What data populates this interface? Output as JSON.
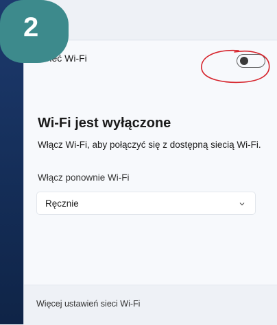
{
  "badge": {
    "number": "2"
  },
  "header": {
    "label": "Sieć Wi-Fi",
    "toggle_state": "off"
  },
  "main": {
    "title": "Wi-Fi jest wyłączone",
    "description": "Włącz Wi-Fi, aby połączyć się z dostępną siecią Wi-Fi.",
    "reenable_label": "Włącz ponownie Wi-Fi",
    "reenable_select": {
      "value": "Ręcznie"
    }
  },
  "footer": {
    "link": "Więcej ustawień sieci Wi-Fi"
  },
  "colors": {
    "badge": "#3d8a8c",
    "annotation": "#d6222a"
  },
  "icons": {
    "select_arrow": "chevron-down-icon"
  }
}
